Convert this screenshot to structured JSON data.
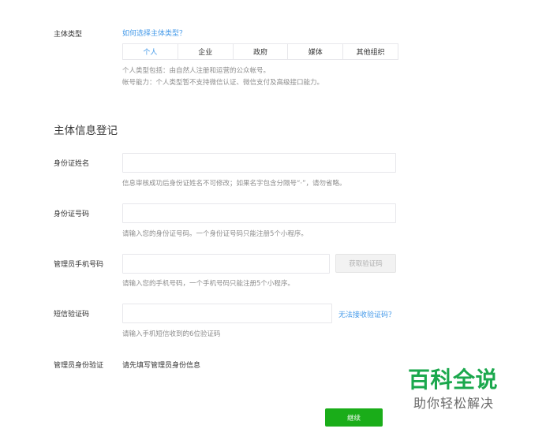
{
  "entity_type": {
    "label": "主体类型",
    "help_link": "如何选择主体类型？",
    "options": [
      "个人",
      "企业",
      "政府",
      "媒体",
      "其他组织"
    ],
    "selected_index": 0,
    "desc_line1": "个人类型包括：由自然人注册和运营的公众帐号。",
    "desc_line2": "帐号能力：个人类型暂不支持微信认证、微信支付及高级接口能力。"
  },
  "section_title": "主体信息登记",
  "id_name": {
    "label": "身份证姓名",
    "value": "",
    "hint": "信息审核成功后身份证姓名不可修改；如果名字包含分隔号“·”，请勿省略。"
  },
  "id_number": {
    "label": "身份证号码",
    "value": "",
    "hint": "请输入您的身份证号码。一个身份证号码只能注册5个小程序。"
  },
  "phone": {
    "label": "管理员手机号码",
    "value": "",
    "get_code_button": "获取验证码",
    "hint": "请输入您的手机号码，一个手机号码只能注册5个小程序。"
  },
  "sms_code": {
    "label": "短信验证码",
    "value": "",
    "help_link": "无法接收验证码？",
    "hint": "请输入手机短信收到的6位验证码"
  },
  "admin_verify": {
    "label": "管理员身份验证",
    "text": "请先填写管理员身份信息"
  },
  "next_button": "继续",
  "watermark": {
    "title": "百科全说",
    "subtitle": "助你轻松解决"
  },
  "colors": {
    "link": "#459ae9",
    "primary_button": "#1aad19",
    "watermark_green": "#1ba84d",
    "hint_text": "#8d8d8d",
    "border": "#e7e7eb"
  }
}
